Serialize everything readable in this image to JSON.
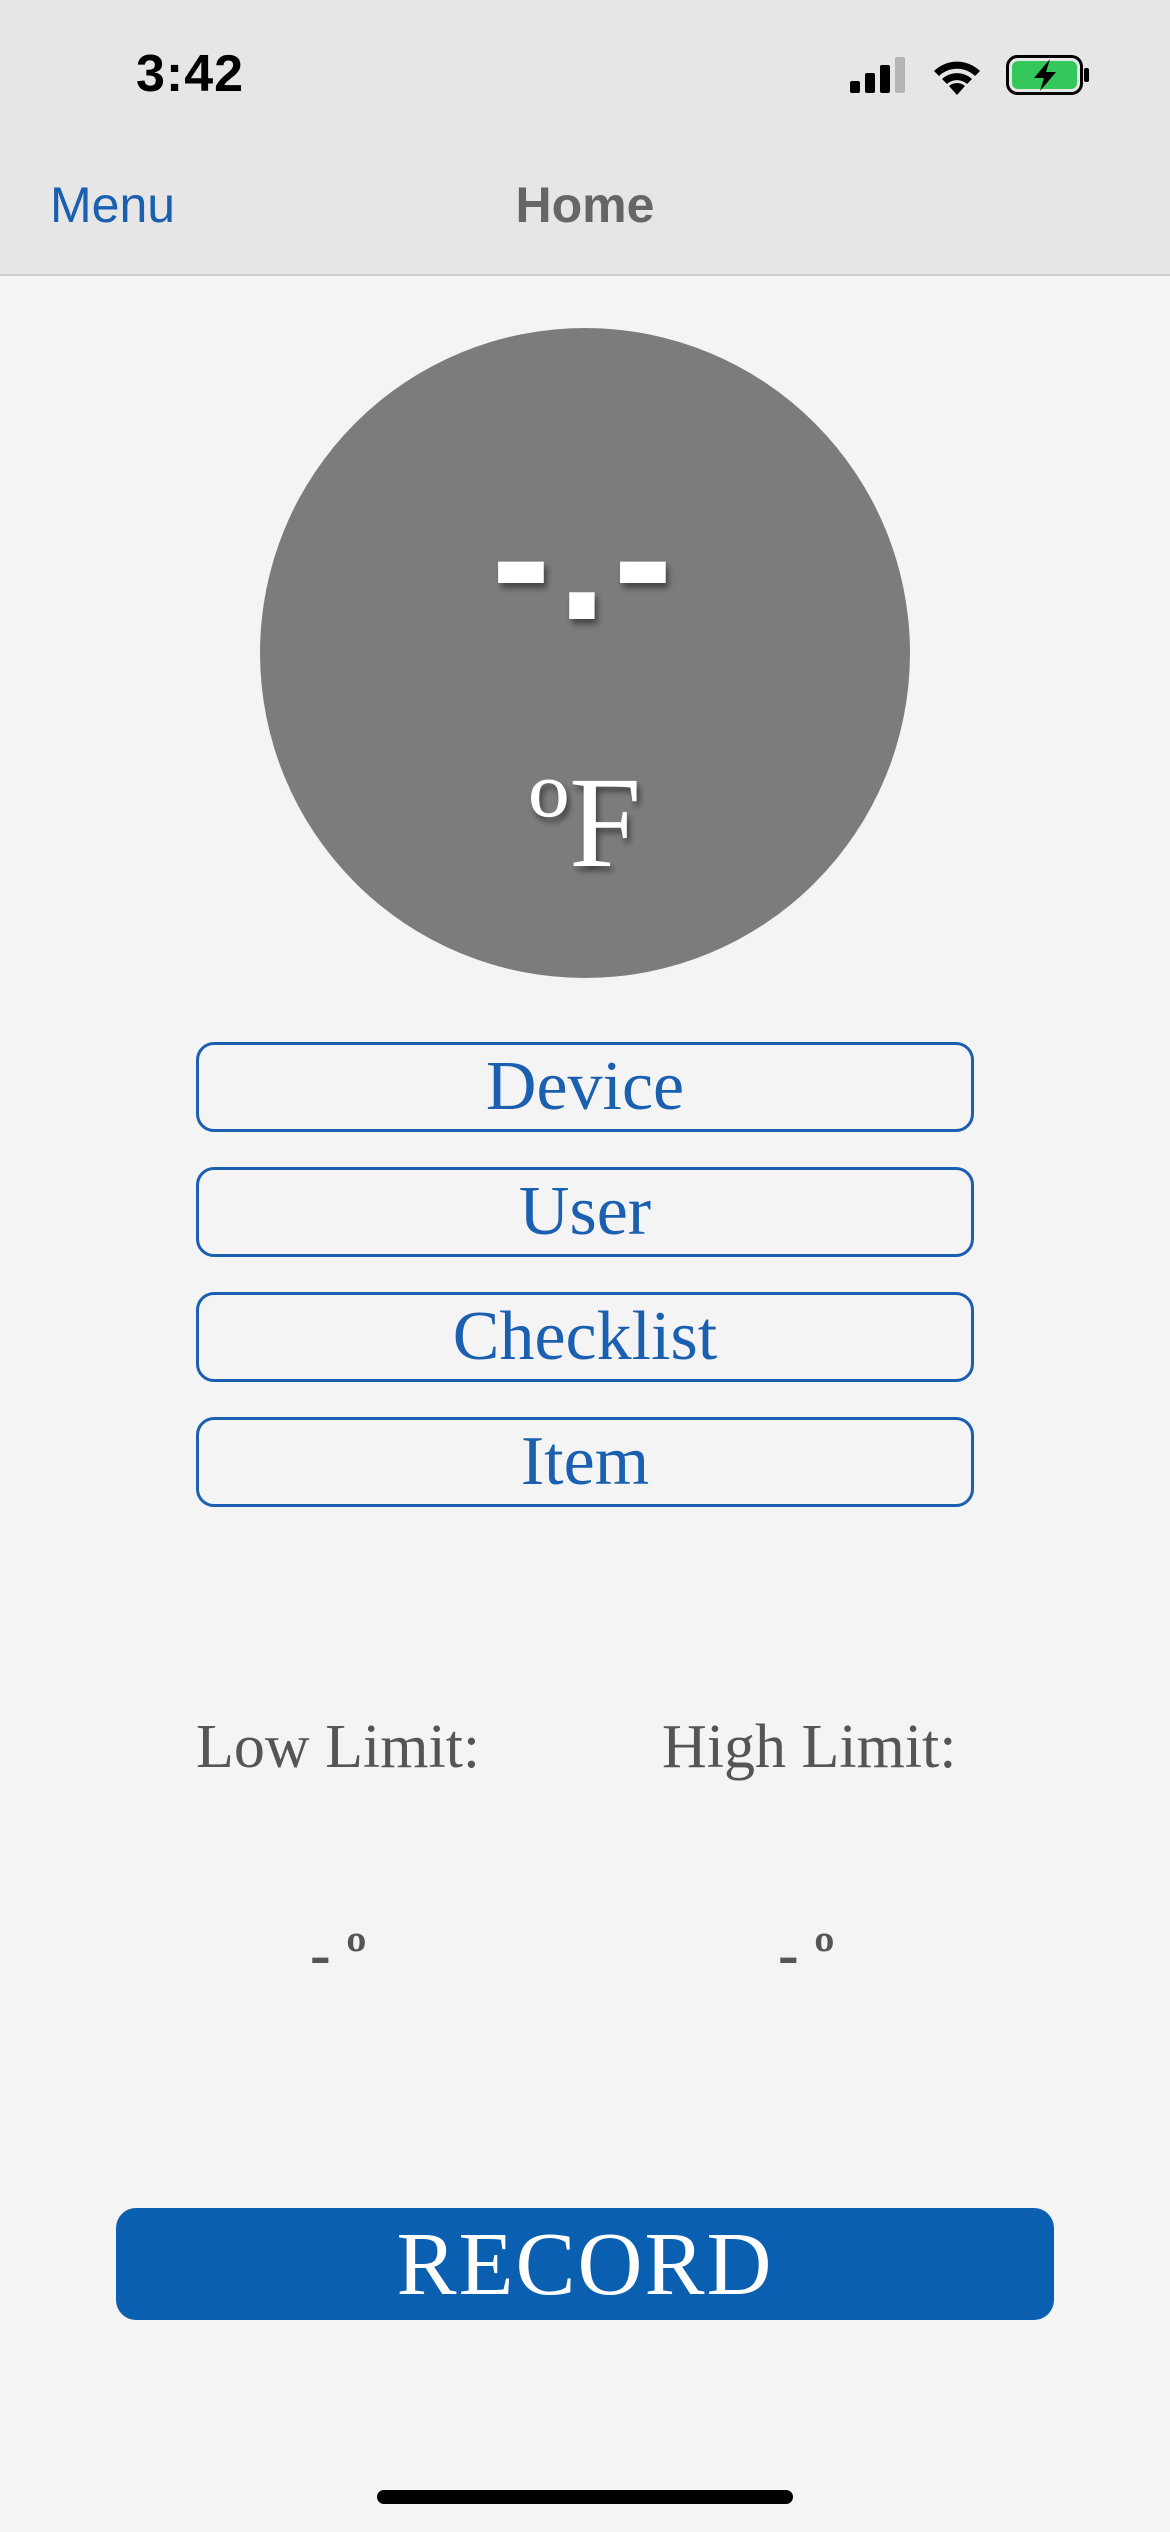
{
  "status_bar": {
    "time": "3:42",
    "icons": [
      "signal-icon",
      "wifi-icon",
      "battery-charging-icon"
    ],
    "battery_color": "#34c759"
  },
  "nav": {
    "menu_label": "Menu",
    "title": "Home"
  },
  "temperature": {
    "value": "-.-",
    "unit": "ºF",
    "circle_color": "#7c7c7c"
  },
  "selectors": {
    "device_label": "Device",
    "user_label": "User",
    "checklist_label": "Checklist",
    "item_label": "Item"
  },
  "limits": {
    "low_label": "Low Limit:",
    "high_label": "High Limit:",
    "low_value": "- º",
    "high_value": "- º"
  },
  "record": {
    "label": "RECORD"
  },
  "colors": {
    "accent": "#1a5fb0",
    "record_bg": "#0b5fb0",
    "background": "#f4f4f4",
    "bar_bg": "#e6e6e6"
  }
}
